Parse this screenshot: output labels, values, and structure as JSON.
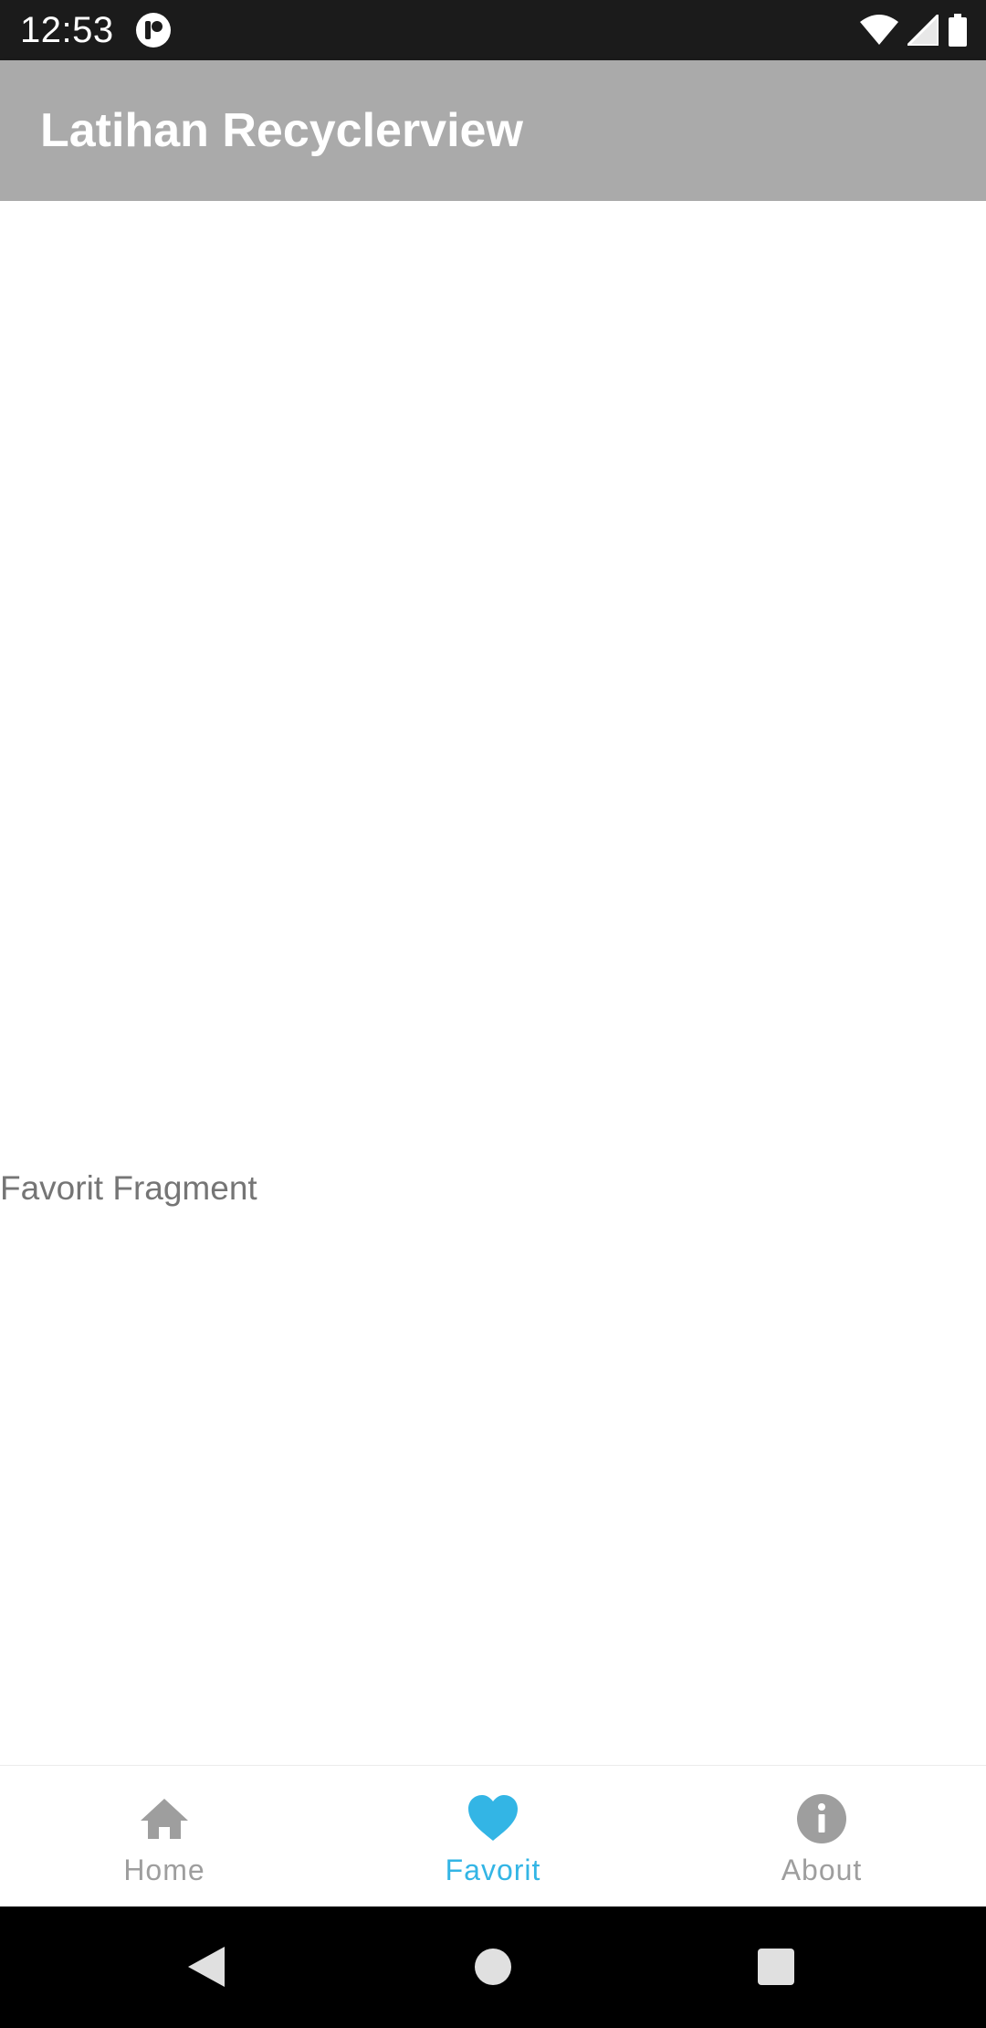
{
  "status_bar": {
    "time": "12:53",
    "icons": [
      "app-notification-icon",
      "wifi-icon",
      "signal-icon",
      "battery-icon"
    ]
  },
  "app_bar": {
    "title": "Latihan Recyclerview",
    "background_color": "#aaaaaa"
  },
  "content": {
    "text": "Favorit Fragment"
  },
  "bottom_nav": {
    "active_color": "#33b5e5",
    "inactive_color": "#9e9e9e",
    "selected": "Favorit",
    "items": [
      {
        "label": "Home",
        "icon": "home-icon"
      },
      {
        "label": "Favorit",
        "icon": "heart-icon"
      },
      {
        "label": "About",
        "icon": "info-icon"
      }
    ]
  },
  "system_nav": {
    "buttons": [
      "back-icon",
      "home-circle-icon",
      "recents-icon"
    ]
  }
}
